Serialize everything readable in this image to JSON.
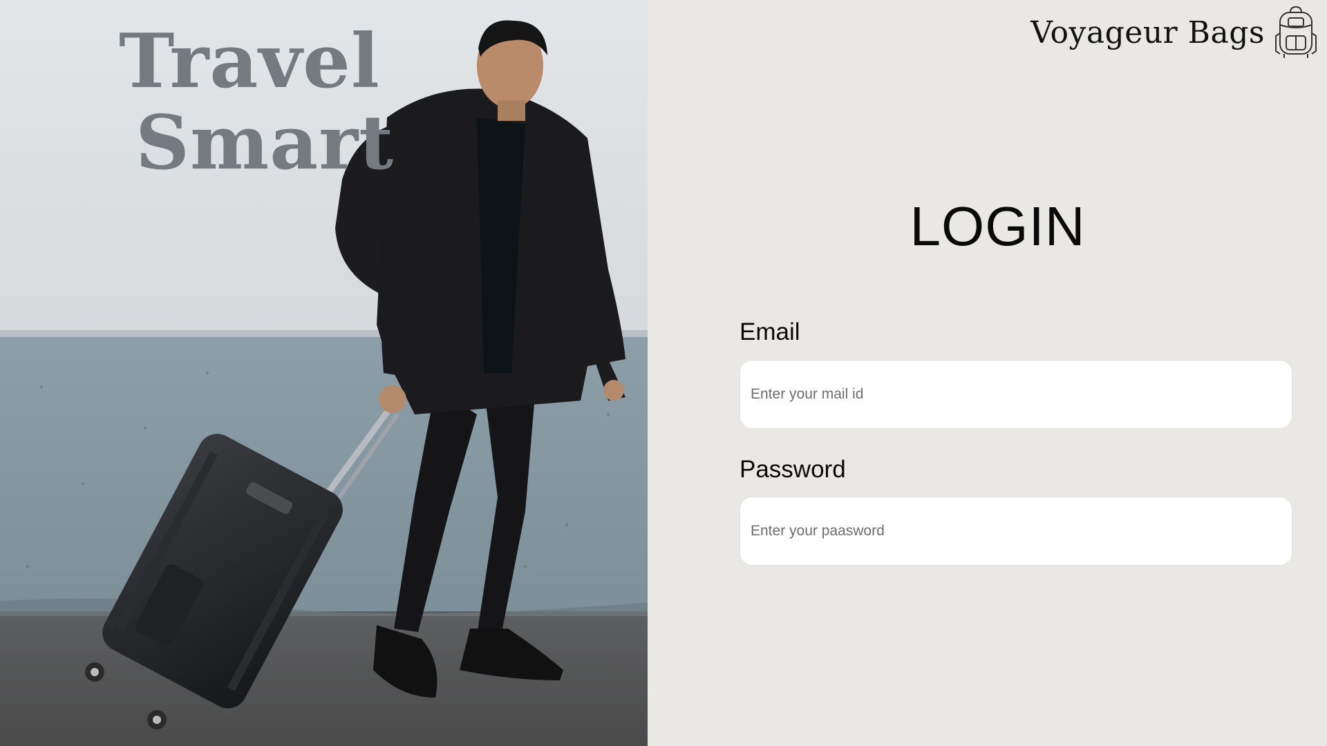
{
  "hero": {
    "headline_line_1": "Travel",
    "headline_line_2": "Smart"
  },
  "brand": {
    "name": "Voyageur Bags",
    "icon": "backpack-icon"
  },
  "login": {
    "title": "LOGIN",
    "email_label": "Email",
    "email_placeholder": "Enter your mail id",
    "email_value": "",
    "password_label": "Password",
    "password_placeholder": "Enter your paasword",
    "password_value": ""
  },
  "colors": {
    "panel_background": "#e9e8e4",
    "headline": "#737b81",
    "input_background": "#ffffff",
    "text": "#0a0a0a"
  }
}
